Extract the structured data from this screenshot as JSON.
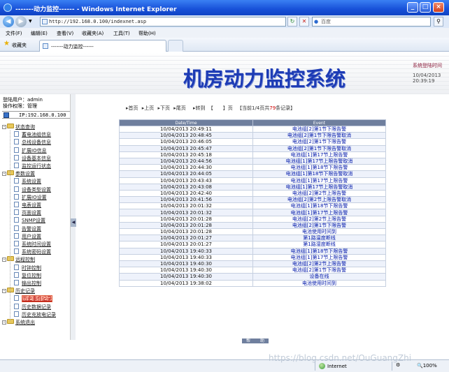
{
  "window": {
    "title": "-------动力监控------ - Windows Internet Explorer"
  },
  "address": {
    "url": "http://192.168.0.100/indexnet.asp",
    "search_placeholder": "百度"
  },
  "menu": [
    "文件(F)",
    "编辑(E)",
    "查看(V)",
    "收藏夹(A)",
    "工具(T)",
    "帮助(H)"
  ],
  "favorites": {
    "label": "收藏夹",
    "tab_title": "-------动力监控------"
  },
  "header": {
    "system_name": "机房动力监控系统",
    "login_time_label": "系统登陆时间",
    "login_date": "10/04/2013",
    "login_clock": "20:39:19"
  },
  "user": {
    "login_user_label": "登陆用户：",
    "login_user": "admin",
    "role_label": "操作权限：",
    "role": "管理",
    "ip": "IP:192.168.0.100"
  },
  "tree": [
    {
      "label": "状态查询",
      "level": 0,
      "folder": true
    },
    {
      "label": "蓄电池组信息",
      "level": 1
    },
    {
      "label": "总线设备信息",
      "level": 1
    },
    {
      "label": "扩展IO信息",
      "level": 1
    },
    {
      "label": "设备基本信息",
      "level": 1
    },
    {
      "label": "监控运行状态",
      "level": 1
    },
    {
      "label": "参数设置",
      "level": 0,
      "folder": true
    },
    {
      "label": "系统设置",
      "level": 1
    },
    {
      "label": "设备类型设置",
      "level": 1
    },
    {
      "label": "扩展IO设置",
      "level": 1
    },
    {
      "label": "电表设置",
      "level": 1
    },
    {
      "label": "页面设置",
      "level": 1
    },
    {
      "label": "SNMP设置",
      "level": 1
    },
    {
      "label": "告警设置",
      "level": 1
    },
    {
      "label": "用户设置",
      "level": 1
    },
    {
      "label": "系统时间设置",
      "level": 1
    },
    {
      "label": "系统密码设置",
      "level": 1
    },
    {
      "label": "远程控制",
      "level": 0,
      "folder": true
    },
    {
      "label": "时钟控制",
      "level": 1
    },
    {
      "label": "复位控制",
      "level": 1
    },
    {
      "label": "输出控制",
      "level": 1
    },
    {
      "label": "历史记录",
      "level": 0,
      "folder": true
    },
    {
      "label": "历史事件记录",
      "level": 1,
      "selected": true
    },
    {
      "label": "历史数据记录",
      "level": 1
    },
    {
      "label": "历史充放电记录",
      "level": 1
    },
    {
      "label": "系统退出",
      "level": 0,
      "folder": true
    }
  ],
  "pager": {
    "first": "首页",
    "prev": "上页",
    "next": "下页",
    "last": "尾页",
    "goto": "转到",
    "brackets": "【　　】页",
    "info_prefix": "【当前1/4页共",
    "total": "79",
    "info_suffix": "条记录】"
  },
  "table": {
    "headers": [
      "Date/Time",
      "Event"
    ],
    "rows": [
      [
        "10/04/2013 20:49:11",
        "电池组[2]第1节下限告警"
      ],
      [
        "10/04/2013 20:48:45",
        "电池组[2]第1节下限告警取消"
      ],
      [
        "10/04/2013 20:46:05",
        "电池组[2]第1节下限告警"
      ],
      [
        "10/04/2013 20:45:47",
        "电池组[2]第1节下限告警取消"
      ],
      [
        "10/04/2013 20:45:18",
        "电池组[1]第17节上限告警"
      ],
      [
        "10/04/2013 20:44:56",
        "电池组[1]第17节上限告警取消"
      ],
      [
        "10/04/2013 20:44:30",
        "电池组[1]第18节下限告警"
      ],
      [
        "10/04/2013 20:44:05",
        "电池组[1]第18节下限告警取消"
      ],
      [
        "10/04/2013 20:43:43",
        "电池组[1]第17节上限告警"
      ],
      [
        "10/04/2013 20:43:08",
        "电池组[1]第17节上限告警取消"
      ],
      [
        "10/04/2013 20:42:40",
        "电池组[2]第2节上限告警"
      ],
      [
        "10/04/2013 20:41:56",
        "电池组[2]第2节上限告警取消"
      ],
      [
        "10/04/2013 20:01:32",
        "电池组[1]第18节下限告警"
      ],
      [
        "10/04/2013 20:01:32",
        "电池组[1]第17节上限告警"
      ],
      [
        "10/04/2013 20:01:28",
        "电池组[2]第2节上限告警"
      ],
      [
        "10/04/2013 20:01:28",
        "电池组[2]第1节下限告警"
      ],
      [
        "10/04/2013 20:01:28",
        "电池使用时间到"
      ],
      [
        "10/04/2013 20:01:27",
        "第1路温度断线"
      ],
      [
        "10/04/2013 20:01:27",
        "第1路湿度断线"
      ],
      [
        "10/04/2013 19:40:33",
        "电池组[1]第18节下限告警"
      ],
      [
        "10/04/2013 19:40:33",
        "电池组[1]第17节上限告警"
      ],
      [
        "10/04/2013 19:40:30",
        "电池组[2]第2节上限告警"
      ],
      [
        "10/04/2013 19:40:30",
        "电池组[2]第1节下限告警"
      ],
      [
        "10/04/2013 19:40:30",
        "设备在线"
      ],
      [
        "10/04/2013 19:38:02",
        "电池使用时间到"
      ]
    ]
  },
  "footer_buttons": [
    "帮",
    "助"
  ],
  "status": {
    "zone": "Internet",
    "zoom": "100%"
  },
  "watermark": "https://blog.csdn.net/OuGuangZhi"
}
